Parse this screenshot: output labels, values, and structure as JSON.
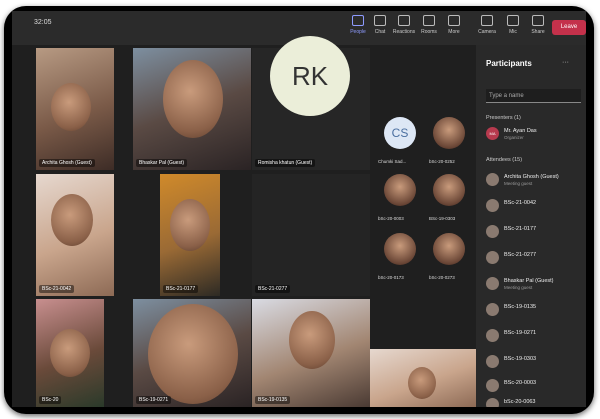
{
  "meeting": {
    "timer": "32:05"
  },
  "toolbar": {
    "people": "People",
    "chat": "Chat",
    "reactions": "Reactions",
    "rooms": "Rooms",
    "more": "More",
    "camera": "Camera",
    "mic": "Mic",
    "share": "Share",
    "leave": "Leave"
  },
  "tiles": {
    "t1": "Archita Ghosh (Guest)",
    "t2": "Bhaskar Pal (Guest)",
    "t3": "Romisha khatun (Guest)",
    "t3_initials": "RK",
    "t4": "BSc-21-0042",
    "t5": "BSc-21-0177",
    "t6": "BSc-21-0277",
    "t7": "BSc-20",
    "t8": "BSc-19-0271",
    "t9": "BSc-19-0135"
  },
  "small_tiles": {
    "s1_initials": "CS",
    "s1": "Chumki Sad...",
    "s2": "bSc-20-0252",
    "s3": "bSc-20-0003",
    "s4": "BSc-19-0303",
    "s5": "bSc-20-0173",
    "s6": "bSc-20-0273"
  },
  "panel": {
    "title": "Participants",
    "more": "···",
    "search_placeholder": "Type a name",
    "presenters_label": "Presenters (1)",
    "attendees_label": "Attendees (15)",
    "presenter": {
      "initials": "MA",
      "name": "Mr. Ayan Das",
      "role": "Organizer"
    },
    "attendees": [
      {
        "name": "Archita Ghosh (Guest)",
        "sub": "Meeting guest"
      },
      {
        "name": "BSc-21-0042",
        "sub": ""
      },
      {
        "name": "BSc-21-0177",
        "sub": ""
      },
      {
        "name": "BSc-21-0277",
        "sub": ""
      },
      {
        "name": "Bhaskar Pal (Guest)",
        "sub": "Meeting guest"
      },
      {
        "name": "BSc-19-0135",
        "sub": ""
      },
      {
        "name": "BSc-19-0271",
        "sub": ""
      },
      {
        "name": "BSc-19-0303",
        "sub": ""
      },
      {
        "name": "BSc-20-0003",
        "sub": ""
      },
      {
        "name": "bSc-20-0063",
        "sub": ""
      }
    ]
  },
  "colors": {
    "accent": "#8e9bff",
    "leave": "#c4314b",
    "panel": "#292929",
    "stage": "#1f1f1f"
  }
}
